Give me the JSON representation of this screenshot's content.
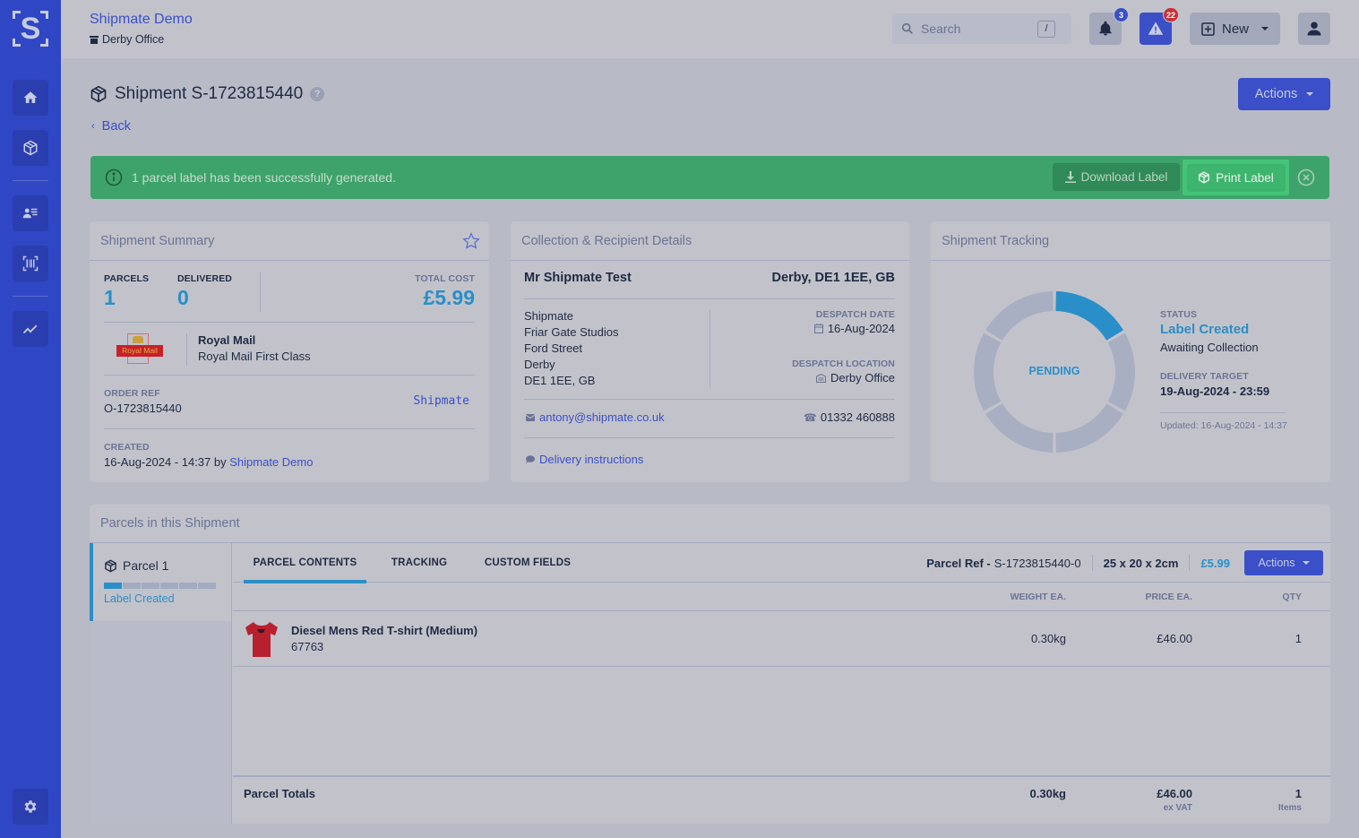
{
  "sidebar": {
    "logo_letter": "S",
    "items": [
      {
        "name": "home",
        "icon": "home-icon"
      },
      {
        "name": "shipments",
        "icon": "package-icon"
      },
      {
        "name": "contacts",
        "icon": "address-book-icon"
      },
      {
        "name": "scan",
        "icon": "barcode-scan-icon"
      },
      {
        "name": "reports",
        "icon": "chart-line-icon"
      },
      {
        "name": "settings",
        "icon": "gear-icon"
      }
    ]
  },
  "topbar": {
    "org_name": "Shipmate Demo",
    "office": "Derby Office",
    "search_placeholder": "Search",
    "search_shortcut": "/",
    "notifications_count": "3",
    "alerts_count": "22",
    "new_label": "New"
  },
  "page": {
    "title": "Shipment S-1723815440",
    "help": "?",
    "back_label": "Back",
    "actions_label": "Actions"
  },
  "banner": {
    "message": "1 parcel label has been successfully generated.",
    "download_label": "Download Label",
    "print_label": "Print Label",
    "colors": {
      "success": "#3ea36a"
    }
  },
  "summary": {
    "title": "Shipment Summary",
    "parcels_label": "PARCELS",
    "parcels_value": "1",
    "delivered_label": "DELIVERED",
    "delivered_value": "0",
    "total_cost_label": "TOTAL COST",
    "total_cost_value": "£5.99",
    "carrier_name": "Royal Mail",
    "carrier_logo_text": "Royal Mail",
    "service": "Royal Mail First Class",
    "order_ref_label": "ORDER REF",
    "order_ref_value": "O-1723815440",
    "channel": "Shipmate",
    "created_label": "CREATED",
    "created_value": "16-Aug-2024 - 14:37 by",
    "created_by": "Shipmate Demo"
  },
  "recipient": {
    "title": "Collection & Recipient Details",
    "name": "Mr Shipmate Test",
    "location": "Derby, DE1 1EE, GB",
    "address_lines": [
      "Shipmate",
      "Friar Gate Studios",
      "Ford Street",
      "Derby",
      "DE1 1EE, GB"
    ],
    "despatch_date_label": "DESPATCH DATE",
    "despatch_date": "16-Aug-2024",
    "despatch_location_label": "DESPATCH LOCATION",
    "despatch_location": "Derby Office",
    "email": "antony@shipmate.co.uk",
    "phone": "01332 460888",
    "delivery_instructions": "Delivery instructions"
  },
  "tracking": {
    "title": "Shipment Tracking",
    "donut_label": "PENDING",
    "stages_total": 6,
    "stages_complete": 1,
    "status_label": "STATUS",
    "status_value": "Label Created",
    "status_sub": "Awaiting Collection",
    "delivery_target_label": "DELIVERY TARGET",
    "delivery_target": "19-Aug-2024 - 23:59",
    "updated": "Updated: 16-Aug-2024 - 14:37",
    "colors": {
      "complete": "#2a8fc8",
      "pending": "#a9afc2"
    }
  },
  "parcels": {
    "title": "Parcels in this Shipment",
    "list": [
      {
        "name": "Parcel 1",
        "status": "Label Created",
        "stages_total": 6,
        "stages_complete": 1
      }
    ],
    "tabs": [
      {
        "label": "PARCEL CONTENTS",
        "active": true
      },
      {
        "label": "TRACKING",
        "active": false
      },
      {
        "label": "CUSTOM FIELDS",
        "active": false
      }
    ],
    "parcel_ref_label": "Parcel Ref -",
    "parcel_ref": "S-1723815440-0",
    "dimensions": "25 x 20 x 2cm",
    "price": "£5.99",
    "actions_label": "Actions",
    "columns": [
      "WEIGHT EA.",
      "PRICE EA.",
      "QTY"
    ],
    "items": [
      {
        "name": "Diesel Mens Red T-shirt (Medium)",
        "sku": "67763",
        "weight": "0.30kg",
        "price": "£46.00",
        "qty": "1"
      }
    ],
    "totals": {
      "label": "Parcel Totals",
      "weight": "0.30kg",
      "price": "£46.00",
      "price_sub": "ex VAT",
      "qty": "1",
      "qty_sub": "Items"
    }
  }
}
